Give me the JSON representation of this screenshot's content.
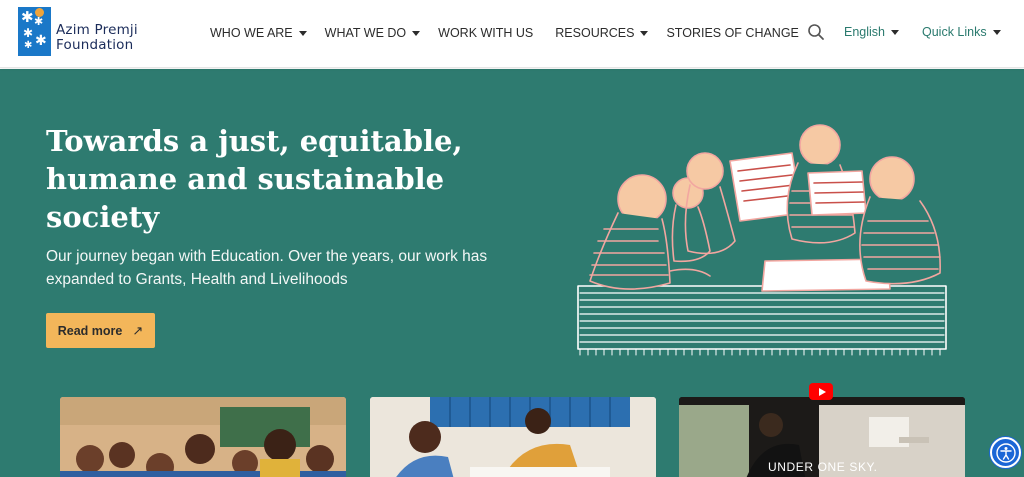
{
  "brand": {
    "name_line1": "Azim Premji",
    "name_line2": "Foundation"
  },
  "nav": {
    "items": [
      {
        "label": "WHO WE ARE",
        "has_dropdown": true
      },
      {
        "label": "WHAT WE DO",
        "has_dropdown": true
      },
      {
        "label": "WORK WITH US",
        "has_dropdown": false
      },
      {
        "label": "RESOURCES",
        "has_dropdown": true
      },
      {
        "label": "STORIES OF CHANGE",
        "has_dropdown": false
      }
    ],
    "search_icon": "search-icon",
    "language": "English",
    "quick_links": "Quick Links"
  },
  "hero": {
    "title": "Towards a just, equitable, humane and sustainable society",
    "subtitle": "Our journey began with Education. Over the years, our work has expanded to Grants, Health and Livelihoods",
    "button_label": "Read more",
    "button_icon": "arrow-up-right-icon",
    "illustration_icon": "children-reading-illustration"
  },
  "cards": [
    {
      "name": "students-classroom-photo"
    },
    {
      "name": "teacher-meeting-photo"
    },
    {
      "name": "video-thumbnail",
      "caption": "UNDER ONE SKY."
    }
  ],
  "colors": {
    "hero_bg": "#2e7b70",
    "button_bg": "#f3b65a",
    "brand_blue": "#1a78c8",
    "link_teal": "#2a7a6e",
    "illustration_line": "#f2a6a0"
  },
  "accessibility_button": "accessibility-icon"
}
